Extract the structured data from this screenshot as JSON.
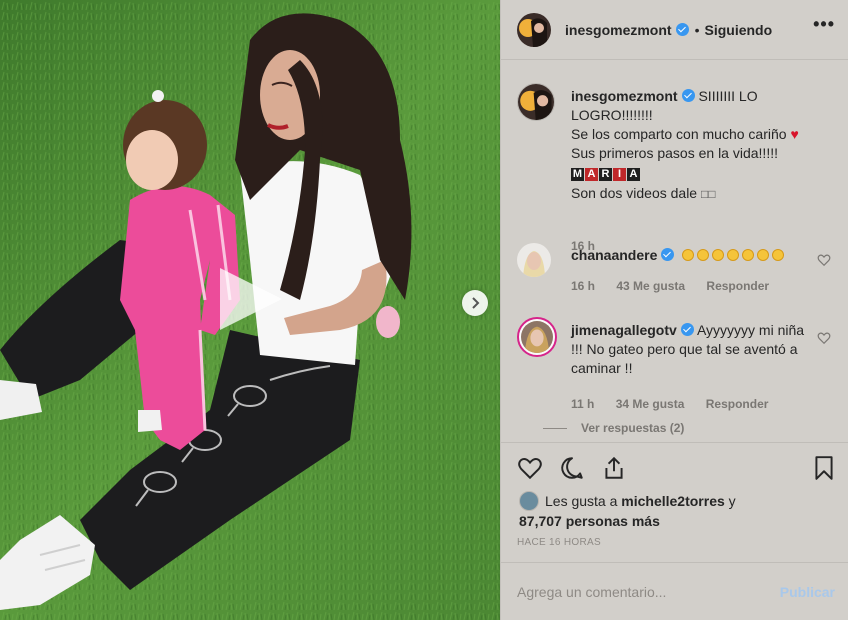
{
  "post": {
    "username": "inesgomezmont",
    "following_label": "Siguiendo",
    "more_label": "•••"
  },
  "caption": {
    "username": "inesgomezmont",
    "line1": "SIIIIIII LO LOGRO!!!!!!!!",
    "line2": "Se los comparto con mucho cariño",
    "line3": "Sus primeros pasos en la vida!!!!!",
    "maria": [
      "M",
      "A",
      "R",
      "I",
      "A"
    ],
    "line5": "Son dos videos dale",
    "time": "16 h"
  },
  "comments": [
    {
      "username": "chanaandere",
      "text_emoji_count": 7,
      "time": "16 h",
      "likes": "43 Me gusta",
      "reply": "Responder"
    },
    {
      "username": "jimenagallegotv",
      "text": "Ayyyyyyy mi niña !!! No gateo pero que tal se aventó a caminar !!",
      "time": "11 h",
      "likes": "34 Me gusta",
      "reply": "Responder",
      "view_replies": "Ver respuestas (2)"
    }
  ],
  "likes_info": {
    "prefix": "Les gusta a",
    "user": "michelle2torres",
    "suffix": "y",
    "count_line": "87,707 personas más"
  },
  "timestamp": "HACE 16 HORAS",
  "comment_box": {
    "placeholder": "Agrega un comentario...",
    "publish": "Publicar"
  },
  "colors": {
    "verified": "#3897f0",
    "heart": "#d8142b",
    "publish_disabled": "#a9c8ea",
    "panel_bg": "#d2cfca"
  },
  "icons": [
    "heart-icon",
    "comment-icon",
    "share-icon",
    "bookmark-icon",
    "play-icon",
    "chevron-right-icon",
    "verified-icon"
  ]
}
